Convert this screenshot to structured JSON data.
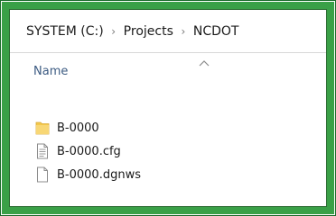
{
  "address_bar": {
    "crumbs": [
      {
        "label": "SYSTEM (C:)"
      },
      {
        "label": "Projects"
      },
      {
        "label": "NCDOT"
      }
    ],
    "separator": ">"
  },
  "column_header": {
    "name_label": "Name",
    "sort_direction": "ascending"
  },
  "files": [
    {
      "name": "B-0000",
      "icon": "folder-icon",
      "type": "folder"
    },
    {
      "name": "B-0000.cfg",
      "icon": "text-file-icon",
      "type": "cfg"
    },
    {
      "name": "B-0000.dgnws",
      "icon": "blank-file-icon",
      "type": "dgnws"
    }
  ],
  "colors": {
    "frame_green": "#3aa047",
    "folder_yellow": "#f3c84b",
    "header_text": "#3c5b82"
  }
}
